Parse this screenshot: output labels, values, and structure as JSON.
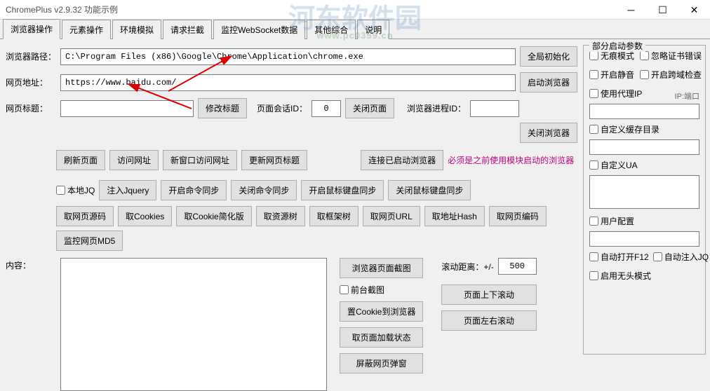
{
  "window": {
    "title": "ChromePlus v2.9.32 功能示例"
  },
  "watermark": {
    "main": "河东软件园",
    "sub": "www.pc0359.cn"
  },
  "tabs": [
    "浏览器操作",
    "元素操作",
    "环境模拟",
    "请求拦截",
    "监控WebSocket数据",
    "其他综合",
    "说明"
  ],
  "labels": {
    "browser_path": "浏览器路径：",
    "url": "网页地址：",
    "title": "网页标题：",
    "content": "内容："
  },
  "fields": {
    "browser_path": "C:\\Program Files (x86)\\Google\\Chrome\\Application\\chrome.exe",
    "url": "https://www.baidu.com/",
    "title": "",
    "session_id": "0",
    "process_id": "",
    "scroll_distance": "500"
  },
  "buttons": {
    "global_init": "全局初始化",
    "start_browser": "启动浏览器",
    "edit_title": "修改标题",
    "session_label": "页面会话ID：",
    "close_page": "关闭页面",
    "process_label": "浏览器进程ID：",
    "close_browser": "关闭浏览器",
    "refresh": "刷新页面",
    "visit": "访问网址",
    "new_window_visit": "新窗口访问网址",
    "update_title": "更新网页标题",
    "connect_started": "连接已启动浏览器",
    "warning": "必须是之前使用模块启动的浏览器",
    "local_jq": "本地JQ",
    "inject_jq": "注入Jquery",
    "sync_cmd_on": "开启命令同步",
    "sync_cmd_off": "关闭命令同步",
    "sync_mouse_on": "开启鼠标键盘同步",
    "sync_mouse_off": "关闭鼠标键盘同步",
    "get_source": "取网页源码",
    "get_cookies": "取Cookies",
    "get_cookie_simple": "取Cookie简化版",
    "get_res_tree": "取资源树",
    "get_frame_tree": "取框架树",
    "get_url": "取网页URL",
    "get_hash": "取地址Hash",
    "get_encoding": "取网页编码",
    "monitor_md5": "监控网页MD5",
    "screenshot": "浏览器页面截图",
    "front_shot": "前台截图",
    "set_cookie": "置Cookie到浏览器",
    "load_state": "取页面加载状态",
    "block_popup": "屏蔽网页弹窗",
    "scroll_label": "滚动距离：+/-",
    "scroll_ud": "页面上下滚动",
    "scroll_lr": "页面左右滚动"
  },
  "side": {
    "title": "部分启动参数",
    "incognito": "无痕模式",
    "ignore_cert": "忽略证书错误",
    "mute": "开启静音",
    "cors": "开启跨域检查",
    "proxy": "使用代理IP",
    "proxy_hint": "IP:端口",
    "cache_dir": "自定义缓存目录",
    "custom_ua": "自定义UA",
    "user_config": "用户配置",
    "auto_f12": "自动打开F12",
    "auto_jq": "自动注入JQ",
    "headless": "启用无头模式"
  }
}
